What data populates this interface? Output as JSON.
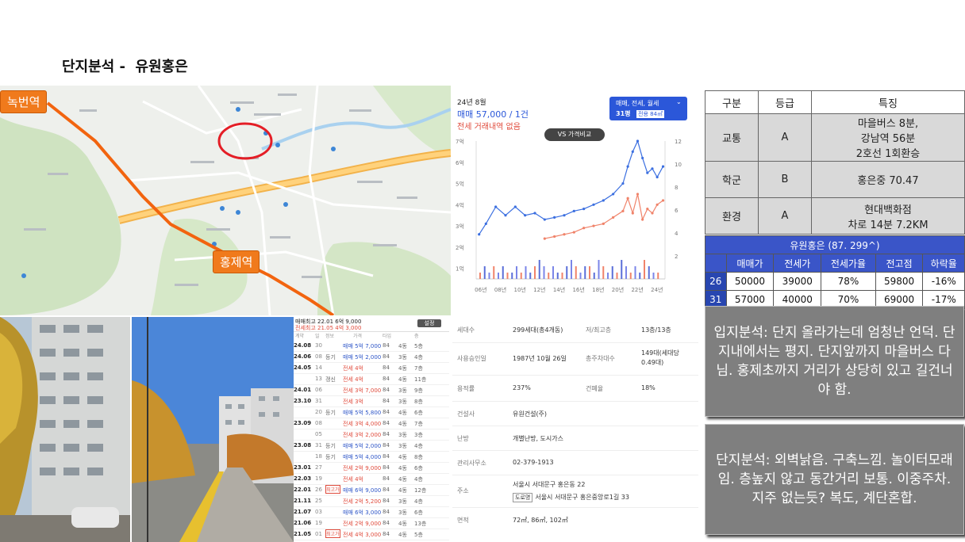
{
  "title": "단지분석 -  유원홍은",
  "map": {
    "stations": [
      "녹번역",
      "홍제역"
    ]
  },
  "price_panel": {
    "month": "24년 8월",
    "sale": "매매 57,000 / 1건",
    "jeonse": "전세 거래내역 없음",
    "filter": "매매, 전세, 월세",
    "pyeong": "31평",
    "area": "전용 84㎡",
    "vs_label": "VS 가격비교"
  },
  "chart_data": {
    "type": "line",
    "x_ticks": [
      "06년",
      "08년",
      "10년",
      "12년",
      "14년",
      "16년",
      "18년",
      "20년",
      "22년",
      "24년"
    ],
    "y_left_ticks": [
      "1억",
      "2억",
      "3억",
      "4억",
      "5억",
      "6억",
      "7억"
    ],
    "y_right_ticks": [
      "2",
      "4",
      "6",
      "8",
      "10",
      "12"
    ],
    "ylim": [
      0.5,
      7
    ],
    "y2lim": [
      0,
      12
    ],
    "x": [
      2005.8,
      2006.5,
      2007.5,
      2008.5,
      2009.5,
      2010.5,
      2011.5,
      2012.5,
      2013.5,
      2014.5,
      2015.5,
      2016.5,
      2017.5,
      2018.5,
      2019.5,
      2020.5,
      2021.0,
      2021.5,
      2022.0,
      2022.5,
      2023.0,
      2023.5,
      2024.0,
      2024.6
    ],
    "series": [
      {
        "color": "#3b6fe0",
        "values": [
          2.6,
          3.1,
          3.9,
          3.5,
          3.9,
          3.5,
          3.6,
          3.3,
          3.4,
          3.5,
          3.7,
          3.8,
          4.0,
          4.2,
          4.5,
          5.0,
          5.8,
          6.5,
          7.0,
          6.2,
          5.5,
          5.7,
          5.3,
          5.8
        ]
      },
      {
        "color": "#f0836a",
        "values": [
          null,
          null,
          null,
          null,
          null,
          null,
          null,
          2.4,
          2.5,
          2.6,
          2.7,
          2.9,
          3.0,
          3.1,
          3.4,
          3.7,
          4.3,
          3.6,
          4.5,
          3.3,
          3.8,
          3.6,
          4.0,
          4.2
        ]
      }
    ],
    "bars": [
      1,
      2,
      1,
      2,
      1,
      2,
      1,
      1,
      2,
      1,
      2,
      1,
      2,
      3,
      2,
      1,
      2,
      1,
      1,
      2,
      3,
      2,
      1,
      2,
      2,
      1,
      3,
      2,
      1,
      2,
      1,
      3,
      2,
      1,
      2,
      1,
      3,
      2,
      1,
      1
    ]
  },
  "deals": {
    "header_sale": "매매최고 22.01 6억 9,000",
    "header_jeonse": "전세최고 21.05 4억 3,000",
    "button": "설정",
    "columns": [
      "계약",
      "일",
      "정보",
      "가격",
      "타입",
      "층"
    ],
    "rows": [
      {
        "date": "24.08",
        "day": "30",
        "tag": "",
        "price": "매매 5억 7,000",
        "kind": "sale",
        "area": "84",
        "type": "4동",
        "floor": "5층"
      },
      {
        "date": "24.06",
        "day": "08",
        "tag": "등기",
        "price": "매매 5억 2,000",
        "kind": "sale",
        "area": "84",
        "type": "3동",
        "floor": "4층"
      },
      {
        "date": "24.05",
        "day": "14",
        "tag": "",
        "price": "전세 4억",
        "kind": "jeonse",
        "area": "84",
        "type": "4동",
        "floor": "7층"
      },
      {
        "date": "",
        "day": "13",
        "tag": "갱신",
        "price": "전세 4억",
        "kind": "jeonse",
        "area": "84",
        "type": "4동",
        "floor": "11층"
      },
      {
        "date": "24.01",
        "day": "06",
        "tag": "",
        "price": "전세 3억 7,000",
        "kind": "jeonse",
        "area": "84",
        "type": "3동",
        "floor": "9층"
      },
      {
        "date": "23.10",
        "day": "31",
        "tag": "",
        "price": "전세 3억",
        "kind": "jeonse",
        "area": "84",
        "type": "3동",
        "floor": "8층"
      },
      {
        "date": "",
        "day": "20",
        "tag": "등기",
        "price": "매매 5억 5,800",
        "kind": "sale",
        "area": "84",
        "type": "4동",
        "floor": "6층"
      },
      {
        "date": "23.09",
        "day": "08",
        "tag": "",
        "price": "전세 3억 4,000",
        "kind": "jeonse",
        "area": "84",
        "type": "4동",
        "floor": "7층"
      },
      {
        "date": "",
        "day": "05",
        "tag": "",
        "price": "전세 3억 2,000",
        "kind": "jeonse",
        "area": "84",
        "type": "3동",
        "floor": "3층"
      },
      {
        "date": "23.08",
        "day": "31",
        "tag": "등기",
        "price": "매매 5억 2,000",
        "kind": "sale",
        "area": "84",
        "type": "3동",
        "floor": "4층"
      },
      {
        "date": "",
        "day": "18",
        "tag": "등기",
        "price": "매매 5억 4,000",
        "kind": "sale",
        "area": "84",
        "type": "4동",
        "floor": "8층"
      },
      {
        "date": "23.01",
        "day": "27",
        "tag": "",
        "price": "전세 2억 9,000",
        "kind": "jeonse",
        "area": "84",
        "type": "4동",
        "floor": "6층"
      },
      {
        "date": "22.03",
        "day": "19",
        "tag": "",
        "price": "전세 4억",
        "kind": "jeonse",
        "area": "84",
        "type": "4동",
        "floor": "4층"
      },
      {
        "date": "22.01",
        "day": "26",
        "tag": "최고가",
        "price": "매매 6억 9,000",
        "kind": "sale",
        "area": "84",
        "type": "4동",
        "floor": "12층"
      },
      {
        "date": "21.11",
        "day": "25",
        "tag": "",
        "price": "전세 2억 5,200",
        "kind": "jeonse",
        "area": "84",
        "type": "3동",
        "floor": "4층"
      },
      {
        "date": "21.07",
        "day": "03",
        "tag": "",
        "price": "매매 6억 3,000",
        "kind": "sale",
        "area": "84",
        "type": "3동",
        "floor": "6층"
      },
      {
        "date": "21.06",
        "day": "19",
        "tag": "",
        "price": "전세 2억 9,000",
        "kind": "jeonse",
        "area": "84",
        "type": "4동",
        "floor": "13층"
      },
      {
        "date": "21.05",
        "day": "01",
        "tag": "최고가",
        "price": "전세 4억 3,000",
        "kind": "jeonse",
        "area": "84",
        "type": "4동",
        "floor": "5층"
      },
      {
        "date": "21.03",
        "day": "01",
        "tag": "",
        "price": "매매 6억",
        "kind": "sale",
        "area": "84",
        "type": "4동",
        "floor": "5층"
      }
    ]
  },
  "basic_info": {
    "households_label": "세대수",
    "households": "299세대(총4개동)",
    "floors_label": "저/최고층",
    "floors": "13층/13층",
    "approval_label": "사용승인일",
    "approval": "1987년 10월 26일",
    "parking_label": "총주차대수",
    "parking": "149대(세대당 0.49대)",
    "far_label": "용적률",
    "far": "237%",
    "bcr_label": "건폐율",
    "bcr": "18%",
    "builder_label": "건설사",
    "builder": "유원건설(주)",
    "heating_label": "난방",
    "heating": "개별난방, 도시가스",
    "office_label": "관리사무소",
    "office": "02-379-1913",
    "address_label": "주소",
    "address": "서울시 서대문구 홍은동 22",
    "road_badge": "도로명",
    "road_address": "서울시 서대문구 홍은중앙로1길 33",
    "area_label": "면적",
    "area": "72㎡, 86㎡, 102㎡"
  },
  "grade_table": {
    "headers": [
      "구분",
      "등급",
      "특징"
    ],
    "rows": [
      {
        "cat": "교통",
        "grade": "A",
        "feat": [
          "마을버스 8분,",
          "강남역 56분",
          "2호선 1회환승"
        ]
      },
      {
        "cat": "학군",
        "grade": "B",
        "feat": [
          "홍은중 70.47"
        ]
      },
      {
        "cat": "환경",
        "grade": "A",
        "feat": [
          "현대백화점",
          "차로 14분 7.2KM"
        ]
      }
    ]
  },
  "summary_table": {
    "title": "유원홍은 (87. 299^)",
    "headers": [
      "",
      "매매가",
      "전세가",
      "전세가율",
      "전고점",
      "하락율"
    ],
    "rows": [
      [
        "26",
        "50000",
        "39000",
        "78%",
        "59800",
        "-16%"
      ],
      [
        "31",
        "57000",
        "40000",
        "70%",
        "69000",
        "-17%"
      ]
    ]
  },
  "notes": {
    "location": "입지분석: 단지 올라가는데 엄청난 언덕. 단지내에서는 평지. 단지앞까지 마을버스 다님. 홍제초까지 거리가 상당히 있고 길건너야 함.",
    "complex": "단지분석: 외벽낡음. 구축느낌. 놀이터모래임. 층높지 않고 동간거리 보통. 이중주차. 지주 없는듯? 복도, 계단혼합."
  }
}
